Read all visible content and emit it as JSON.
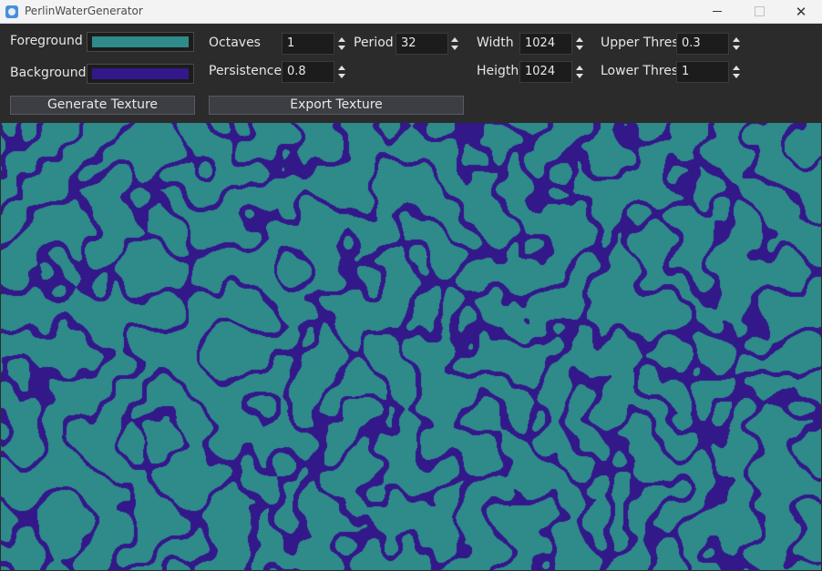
{
  "window": {
    "title": "PerlinWaterGenerator"
  },
  "colors": {
    "foreground": "#2f8a8a",
    "background": "#33188a"
  },
  "fields": {
    "foreground_label": "Foreground",
    "background_label": "Background",
    "octaves": {
      "label": "Octaves",
      "value": "1"
    },
    "period": {
      "label": "Period",
      "value": "32"
    },
    "persistence": {
      "label": "Persistence",
      "value": "0.8"
    },
    "width": {
      "label": "Width",
      "value": "1024"
    },
    "height": {
      "label": "Heigth",
      "value": "1024"
    },
    "upper_thres": {
      "label": "Upper Thres",
      "value": "0.3"
    },
    "lower_thres": {
      "label": "Lower Thres",
      "value": "1"
    }
  },
  "buttons": {
    "generate": "Generate Texture",
    "export": "Export Texture"
  }
}
